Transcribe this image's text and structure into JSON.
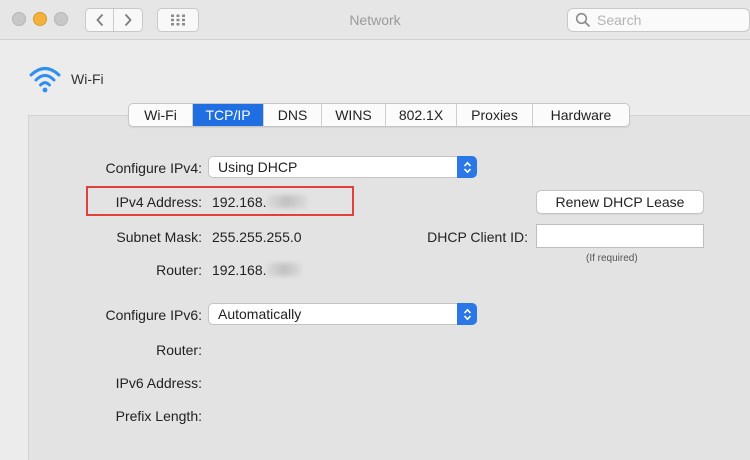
{
  "window": {
    "title": "Network",
    "search_placeholder": "Search"
  },
  "interface": {
    "name": "Wi-Fi",
    "icon": "wifi-icon"
  },
  "tabs": [
    {
      "label": "Wi-Fi",
      "active": false
    },
    {
      "label": "TCP/IP",
      "active": true
    },
    {
      "label": "DNS",
      "active": false
    },
    {
      "label": "WINS",
      "active": false
    },
    {
      "label": "802.1X",
      "active": false
    },
    {
      "label": "Proxies",
      "active": false
    },
    {
      "label": "Hardware",
      "active": false
    }
  ],
  "ipv4": {
    "configure_label": "Configure IPv4:",
    "configure_value": "Using DHCP",
    "address_label": "IPv4 Address:",
    "address_value": "192.168.",
    "subnet_label": "Subnet Mask:",
    "subnet_value": "255.255.255.0",
    "router_label": "Router:",
    "router_value": "192.168."
  },
  "dhcp": {
    "renew_label": "Renew DHCP Lease",
    "client_id_label": "DHCP Client ID:",
    "client_id_value": "",
    "client_id_hint": "(If required)"
  },
  "ipv6": {
    "configure_label": "Configure IPv6:",
    "configure_value": "Automatically",
    "router_label": "Router:",
    "address_label": "IPv6 Address:",
    "prefix_label": "Prefix Length:"
  },
  "colors": {
    "accent": "#1f6fe2",
    "highlight": "#e0413d"
  }
}
